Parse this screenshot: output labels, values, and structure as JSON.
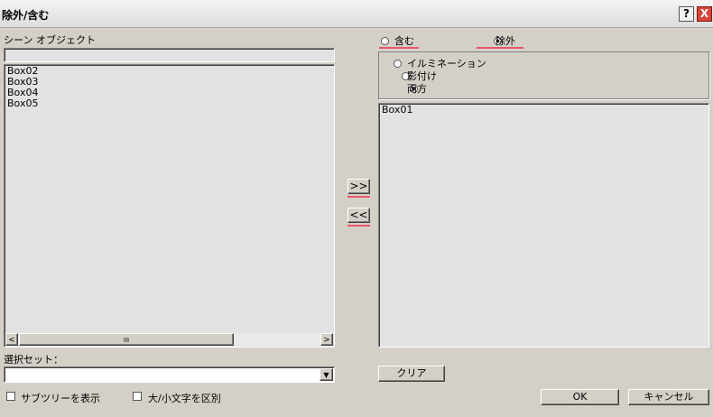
{
  "window": {
    "title": "除外/含む",
    "help_label": "?",
    "close_label": "X"
  },
  "left": {
    "scene_objects_label": "シーン オブジェクト",
    "filter_value": "",
    "objects": [
      "Box02",
      "Box03",
      "Box04",
      "Box05"
    ],
    "hscroll_left": "<",
    "hscroll_right": ">",
    "hscroll_grip": "III"
  },
  "selection_set": {
    "label": "選択セット：",
    "value": "",
    "arrow": "▼"
  },
  "options": {
    "subtree_label": "サブツリーを表示",
    "case_label": "大/小文字を区別"
  },
  "transfer": {
    "add_label": ">>",
    "remove_label": "<<"
  },
  "mode": {
    "include_label": "含む",
    "exclude_label": "除外",
    "selected": "exclude"
  },
  "target": {
    "options": [
      "イルミネーション",
      "影付け",
      "両方"
    ],
    "selected_index": 2
  },
  "right": {
    "objects": [
      "Box01"
    ]
  },
  "buttons": {
    "clear_label": "クリア",
    "ok_label": "OK",
    "cancel_label": "キャンセル"
  },
  "colors": {
    "highlight_underline": "#e8586a"
  }
}
